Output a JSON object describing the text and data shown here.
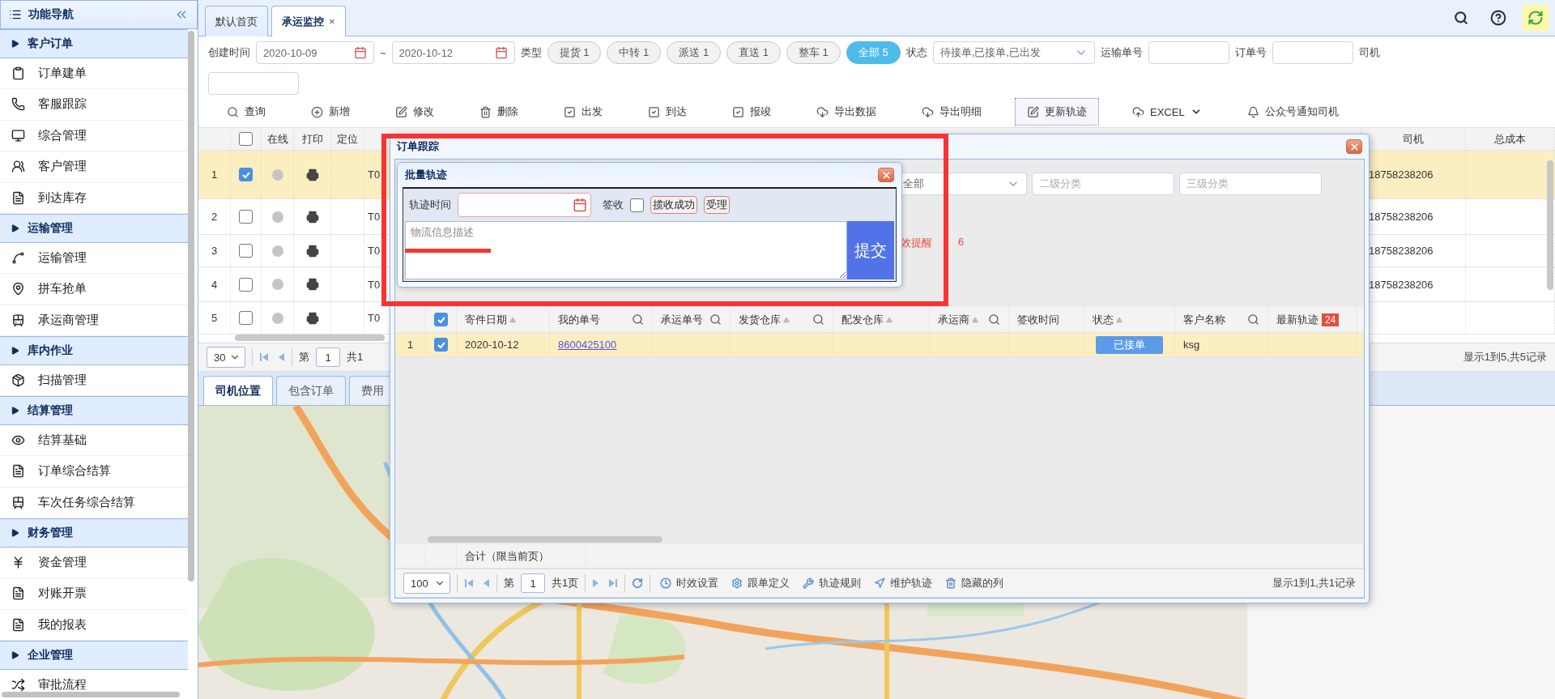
{
  "sidebar": {
    "title": "功能导航",
    "groups": [
      {
        "label": "客户订单",
        "items": [
          {
            "label": "订单建单"
          },
          {
            "label": "客服跟踪"
          },
          {
            "label": "综合管理"
          },
          {
            "label": "客户管理"
          },
          {
            "label": "到达库存"
          }
        ]
      },
      {
        "label": "运输管理",
        "items": [
          {
            "label": "运输管理"
          },
          {
            "label": "拼车抢单"
          },
          {
            "label": "承运商管理"
          }
        ]
      },
      {
        "label": "库内作业",
        "items": [
          {
            "label": "扫描管理"
          }
        ]
      },
      {
        "label": "结算管理",
        "items": [
          {
            "label": "结算基础"
          },
          {
            "label": "订单综合结算"
          },
          {
            "label": "车次任务综合结算"
          }
        ]
      },
      {
        "label": "财务管理",
        "items": [
          {
            "label": "资金管理"
          },
          {
            "label": "对账开票"
          },
          {
            "label": "我的报表"
          }
        ]
      },
      {
        "label": "企业管理",
        "items": [
          {
            "label": "审批流程"
          }
        ]
      }
    ]
  },
  "tabs": [
    {
      "label": "默认首页",
      "selected": false
    },
    {
      "label": "承运监控",
      "selected": true,
      "close": "×"
    }
  ],
  "top_actions": [
    {
      "kind": "search",
      "selected": false
    },
    {
      "kind": "help",
      "selected": false
    },
    {
      "kind": "refresh",
      "selected": true
    }
  ],
  "filters": {
    "created_label": "创建时间",
    "date_from": "2020-10-09",
    "range_sep": "~",
    "date_to": "2020-10-12",
    "type_label": "类型",
    "types": [
      {
        "label": "提货 1",
        "selected": false
      },
      {
        "label": "中转 1",
        "selected": false
      },
      {
        "label": "派送 1",
        "selected": false
      },
      {
        "label": "直送 1",
        "selected": false
      },
      {
        "label": "整车 1",
        "selected": false
      },
      {
        "label": "全部 5",
        "selected": true
      }
    ],
    "status_label": "状态",
    "status_value": "待接单,已接单,已出发",
    "waybill_label": "运输单号",
    "order_label": "订单号",
    "driver_label": "司机"
  },
  "toolbar": [
    {
      "label": "查询",
      "focused": false
    },
    {
      "label": "新增",
      "focused": false
    },
    {
      "label": "修改",
      "focused": false
    },
    {
      "label": "删除",
      "focused": false
    },
    {
      "label": "出发",
      "focused": false
    },
    {
      "label": "到达",
      "focused": false
    },
    {
      "label": "报竣",
      "focused": false
    },
    {
      "label": "导出数据",
      "focused": false
    },
    {
      "label": "导出明细",
      "focused": false
    },
    {
      "label": "更新轨迹",
      "focused": true
    },
    {
      "label": "EXCEL",
      "focused": false,
      "menu": true
    },
    {
      "label": "公众号通知司机",
      "focused": false
    }
  ],
  "table": {
    "header_checked": false,
    "columns": [
      {
        "label": "在线"
      },
      {
        "label": "打印"
      },
      {
        "label": "定位"
      },
      {
        "label": "司机"
      },
      {
        "label": "总成本"
      }
    ],
    "rows": [
      {
        "num": "1",
        "checked": true,
        "selected": true,
        "online": false,
        "waybill": "T0",
        "driver": "18758238206"
      },
      {
        "num": "2",
        "checked": false,
        "selected": false,
        "online": false,
        "waybill": "T0",
        "driver": "18758238206"
      },
      {
        "num": "3",
        "checked": false,
        "selected": false,
        "online": false,
        "waybill": "T0",
        "driver": "18758238206"
      },
      {
        "num": "4",
        "checked": false,
        "selected": false,
        "online": false,
        "waybill": "T0",
        "driver": "18758238206"
      },
      {
        "num": "5",
        "checked": false,
        "selected": false,
        "online": false,
        "waybill": "T0"
      }
    ]
  },
  "pager": {
    "page_size": "30",
    "page_label": "第",
    "page": "1",
    "total": "共1",
    "summary": "显示1到5,共5记录"
  },
  "bottom_tabs": [
    {
      "label": "司机位置",
      "selected": true
    },
    {
      "label": "包含订单",
      "selected": false
    },
    {
      "label": "费用",
      "selected": false
    }
  ],
  "order_dialog": {
    "title": "订单跟踪",
    "category": "全部",
    "level2": "二级分类",
    "level3": "三级分类",
    "alert_label": "效提醒",
    "alert_count": "6",
    "header_checked": true,
    "columns": [
      {
        "label": "寄件日期",
        "sort": true,
        "search": false
      },
      {
        "label": "我的单号",
        "sort": false,
        "search": true
      },
      {
        "label": "承运单号",
        "sort": false,
        "search": true
      },
      {
        "label": "发货仓库",
        "sort": true,
        "search": true
      },
      {
        "label": "配发仓库",
        "sort": true,
        "search": false
      },
      {
        "label": "承运商",
        "sort": true,
        "search": true
      },
      {
        "label": "签收时间",
        "sort": false,
        "search": false
      },
      {
        "label": "状态",
        "sort": true,
        "search": false
      },
      {
        "label": "客户名称",
        "sort": false,
        "search": true
      },
      {
        "label": "最新轨迹",
        "sort": false,
        "search": false,
        "badge": "24"
      }
    ],
    "rows": [
      {
        "num": "1",
        "checked": true,
        "selected": true,
        "date": "2020-10-12",
        "order_no": "8600425100",
        "status": "已接单",
        "customer": "ksg"
      }
    ],
    "footer_label": "合计（限当前页）",
    "pager": {
      "page_size": "100",
      "page_label": "第",
      "page": "1",
      "total": "共1页",
      "actions": [
        {
          "label": "时效设置"
        },
        {
          "label": "跟单定义"
        },
        {
          "label": "轨迹规则"
        },
        {
          "label": "维护轨迹"
        },
        {
          "label": "隐藏的列"
        }
      ],
      "summary": "显示1到1,共1记录"
    }
  },
  "batch_dialog": {
    "title": "批量轨迹",
    "time_label": "轨迹时间",
    "sign_label": "签收",
    "signed": false,
    "quick_buttons": [
      {
        "label": "揽收成功"
      },
      {
        "label": "受理"
      }
    ],
    "description_placeholder": "物流信息描述",
    "submit": "提交"
  },
  "annotations": {
    "frame": true,
    "underline": true
  }
}
